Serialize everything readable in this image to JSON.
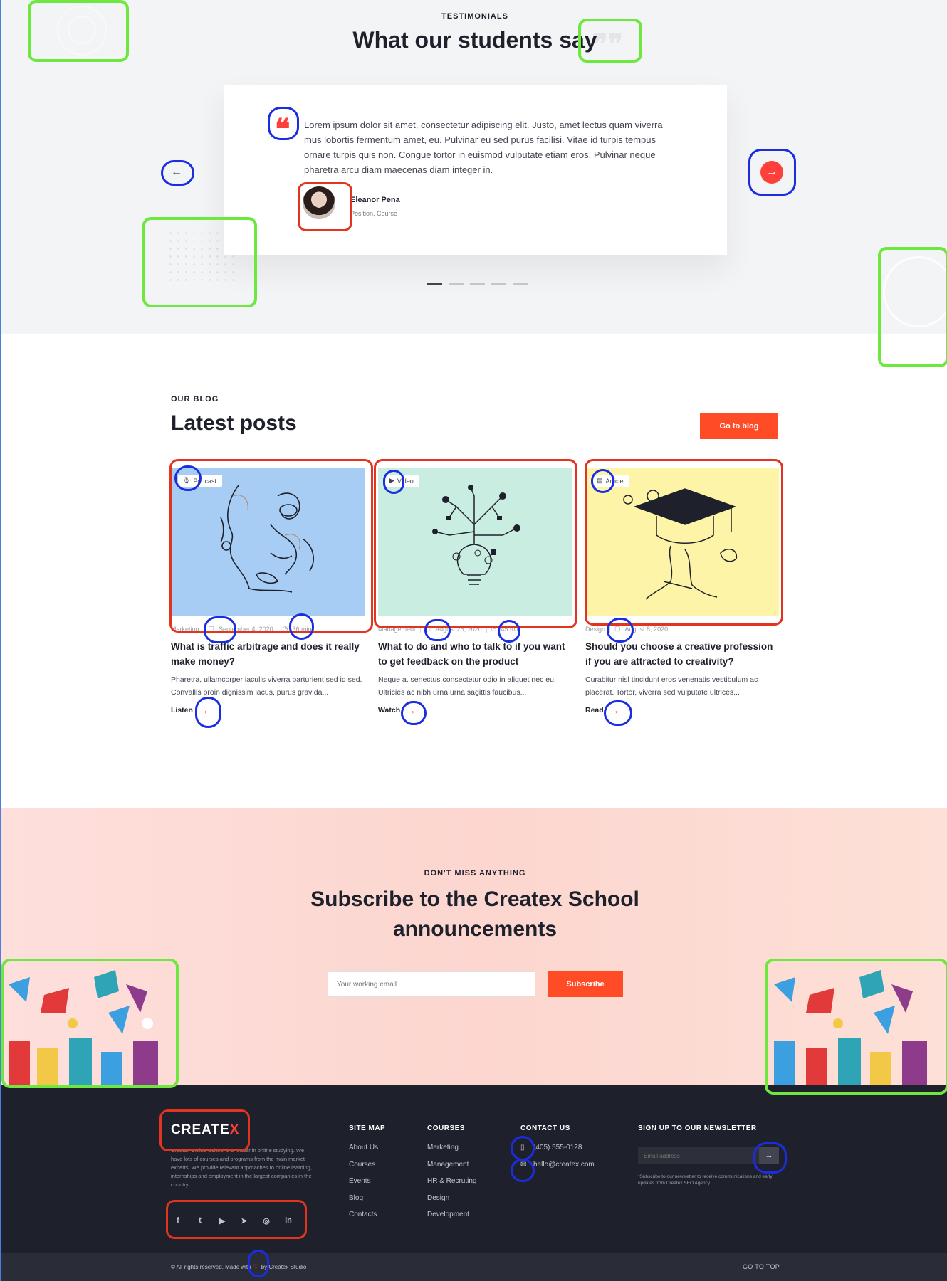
{
  "testimonials": {
    "eyebrow": "TESTIMONIALS",
    "title": "What our students say",
    "quote": "Lorem ipsum dolor sit amet, consectetur adipiscing elit. Justo, amet lectus quam viverra mus lobortis fermentum amet, eu. Pulvinar eu sed purus facilisi. Vitae id turpis tempus ornare turpis quis non. Congue tortor in euismod vulputate etiam eros. Pulvinar neque pharetra arcu diam maecenas diam integer in.",
    "author_name": "Eleanor Pena",
    "author_position": "Position, Course",
    "prev_label": "←",
    "next_label": "→",
    "slide_count": 5,
    "active_slide": 1
  },
  "blog": {
    "eyebrow": "OUR BLOG",
    "title": "Latest posts",
    "go_label": "Go to blog",
    "posts": [
      {
        "tag": "Podcast",
        "tag_icon": "microphone-icon",
        "category": "Marketing",
        "date": "September 4, 2020",
        "duration": "36 min",
        "title": "What is traffic arbitrage and does it really make money?",
        "excerpt": "Pharetra, ullamcorper iaculis viverra parturient sed id sed. Convallis proin dignissim lacus, purus gravida...",
        "link": "Listen",
        "image_bg": "#a8cdf4"
      },
      {
        "tag": "Video",
        "tag_icon": "play-icon",
        "category": "Management",
        "date": "August 25, 2020",
        "duration": "45 min",
        "title": "What to do and who to talk to if you want to get feedback on the product",
        "excerpt": "Neque a, senectus consectetur odio in aliquet nec eu. Ultricies ac nibh urna urna sagittis faucibus...",
        "link": "Watch",
        "image_bg": "#c9ede1"
      },
      {
        "tag": "Article",
        "tag_icon": "file-icon",
        "category": "Design",
        "date": "August 8, 2020",
        "duration": "",
        "title": "Should you choose a creative profession if you are attracted to creativity?",
        "excerpt": "Curabitur nisl tincidunt eros venenatis vestibulum ac placerat. Tortor, viverra sed vulputate ultrices...",
        "link": "Read",
        "image_bg": "#fdf4a7"
      }
    ]
  },
  "subscribe": {
    "eyebrow": "DON'T MISS ANYTHING",
    "title": "Subscribe to the Createx School announcements",
    "placeholder": "Your working email",
    "button": "Subscribe"
  },
  "footer": {
    "logo_text": "CREATE",
    "logo_x": "X",
    "about": "Createx Online School is a leader in online studying. We have lots of courses and programs from the main market experts. We provide relevant approaches to online learning, internships and employment in the largest companies in the country.",
    "sitemap": {
      "title": "SITE MAP",
      "links": [
        "About Us",
        "Courses",
        "Events",
        "Blog",
        "Contacts"
      ]
    },
    "courses": {
      "title": "COURSES",
      "links": [
        "Marketing",
        "Management",
        "HR & Recruting",
        "Design",
        "Development"
      ]
    },
    "contact": {
      "title": "CONTACT US",
      "phone": "(405) 555-0128",
      "email": "hello@createx.com"
    },
    "newsletter": {
      "title": "SIGN UP TO OUR NEWSLETTER",
      "placeholder": "Email address",
      "button": "→",
      "note": "*Subscribe to our newsletter to receive communications and early updates from Createx SEO Agency."
    },
    "socials": [
      "f",
      "t",
      "▶",
      "➤",
      "◎",
      "in"
    ],
    "copyright_a": "© All rights reserved. Made with",
    "copyright_heart": "♡",
    "copyright_b": "by Createx Studio",
    "go_top": "GO TO TOP"
  },
  "colors": {
    "accent": "#ff3f3a",
    "accent_button": "#ff4b26",
    "dark": "#1e212c",
    "annotation_green": "#6ee83f",
    "annotation_red": "#e2341e",
    "annotation_blue": "#1a2de0"
  }
}
